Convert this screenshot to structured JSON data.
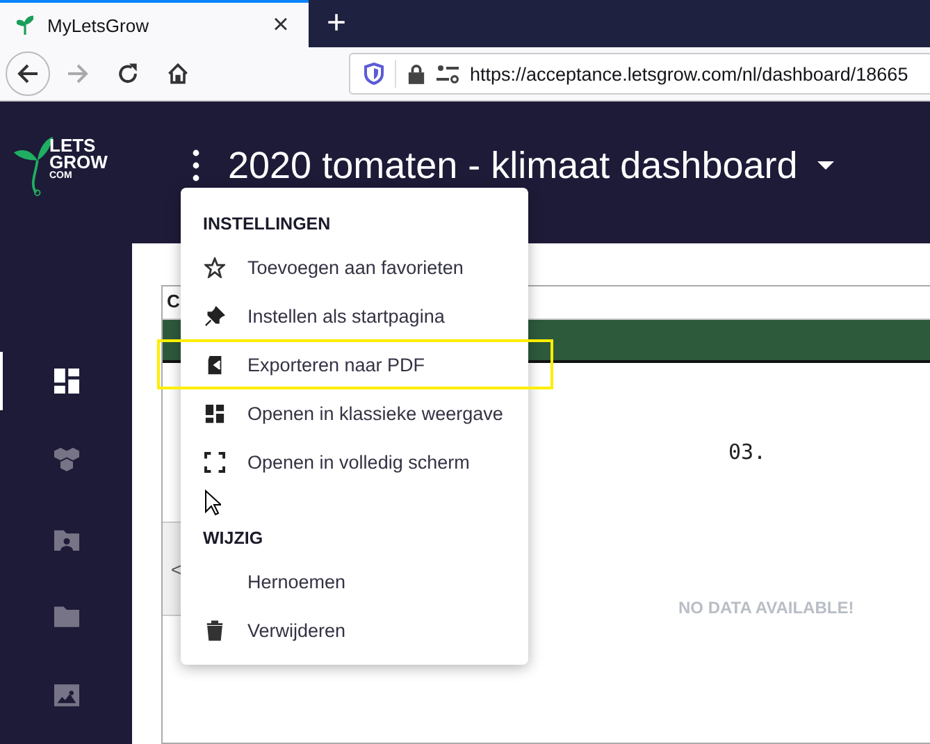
{
  "browser": {
    "tab": {
      "title": "MyLetsGrow",
      "close": "×",
      "selected": true
    },
    "new_tab": "+",
    "back_disabled": false,
    "forward_disabled": true,
    "url": "https://acceptance.letsgrow.com/nl/dashboard/18665"
  },
  "app": {
    "logo": [
      "LETS",
      "GROW",
      "COM"
    ],
    "title": "2020 tomaten - klimaat dashboard",
    "sidebar": [
      {
        "selected": true
      },
      {
        "selected": false
      },
      {
        "selected": false
      },
      {
        "selected": false
      },
      {
        "selected": false
      }
    ]
  },
  "card": {
    "title": "C",
    "value": "03.",
    "empty_message": "NO DATA AVAILABLE!",
    "pager": "<"
  },
  "menu": {
    "sections": [
      {
        "heading": "INSTELLINGEN",
        "items": [
          {
            "label": "Toevoegen aan favorieten",
            "highlighted": false
          },
          {
            "label": "Instellen als startpagina",
            "highlighted": false
          },
          {
            "label": "Exporteren naar PDF",
            "highlighted": true
          },
          {
            "label": "Openen in klassieke weergave",
            "highlighted": false
          },
          {
            "label": "Openen in volledig scherm",
            "highlighted": false
          }
        ]
      },
      {
        "heading": "WIJZIG",
        "items": [
          {
            "label": "Hernoemen",
            "highlighted": false
          },
          {
            "label": "Verwijderen",
            "highlighted": false
          }
        ]
      }
    ]
  }
}
